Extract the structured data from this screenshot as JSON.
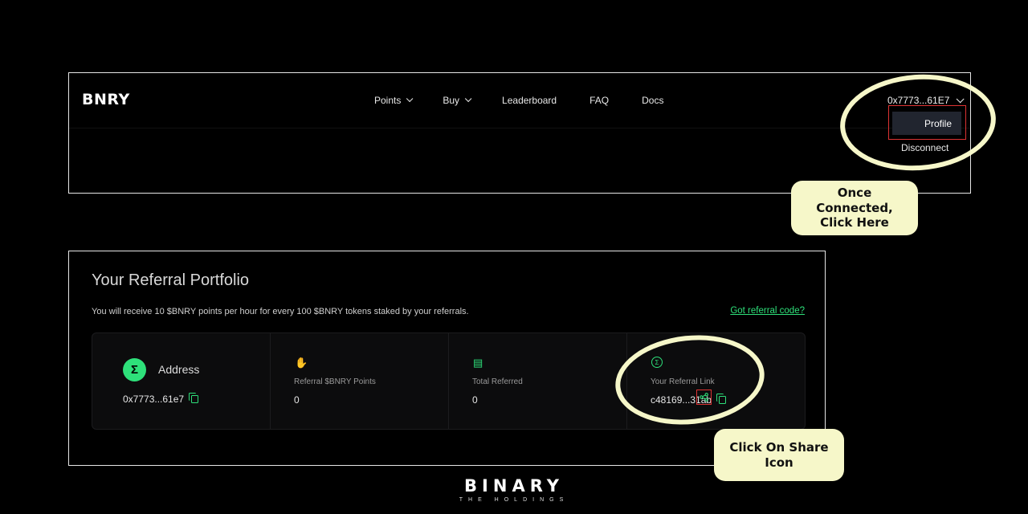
{
  "navbar": {
    "logo": "BNRY",
    "items": [
      {
        "label": "Points"
      },
      {
        "label": "Buy"
      },
      {
        "label": "Leaderboard"
      },
      {
        "label": "FAQ"
      },
      {
        "label": "Docs"
      }
    ],
    "wallet": "0x7773...61E7",
    "menu": {
      "profile": "Profile",
      "disconnect": "Disconnect"
    }
  },
  "callouts": {
    "connected": "Once Connected, Click Here",
    "share": "Click On Share Icon"
  },
  "referral": {
    "title": "Your Referral Portfolio",
    "description": "You will receive 10 $BNRY points per hour for every 100 $BNRY tokens staked by your referrals.",
    "got_code": "Got referral code?",
    "address": {
      "label": "Address",
      "value": "0x7773...61e7"
    },
    "points": {
      "label": "Referral $BNRY Points",
      "value": "0"
    },
    "total": {
      "label": "Total Referred",
      "value": "0"
    },
    "link": {
      "label": "Your Referral Link",
      "value": "c48169...31ab"
    }
  },
  "brand": {
    "name": "BINARY",
    "sub": "THE HOLDINGS"
  },
  "colors": {
    "accent": "#2ee07a",
    "callout": "#f6f7c9",
    "highlight": "#dd3333"
  }
}
